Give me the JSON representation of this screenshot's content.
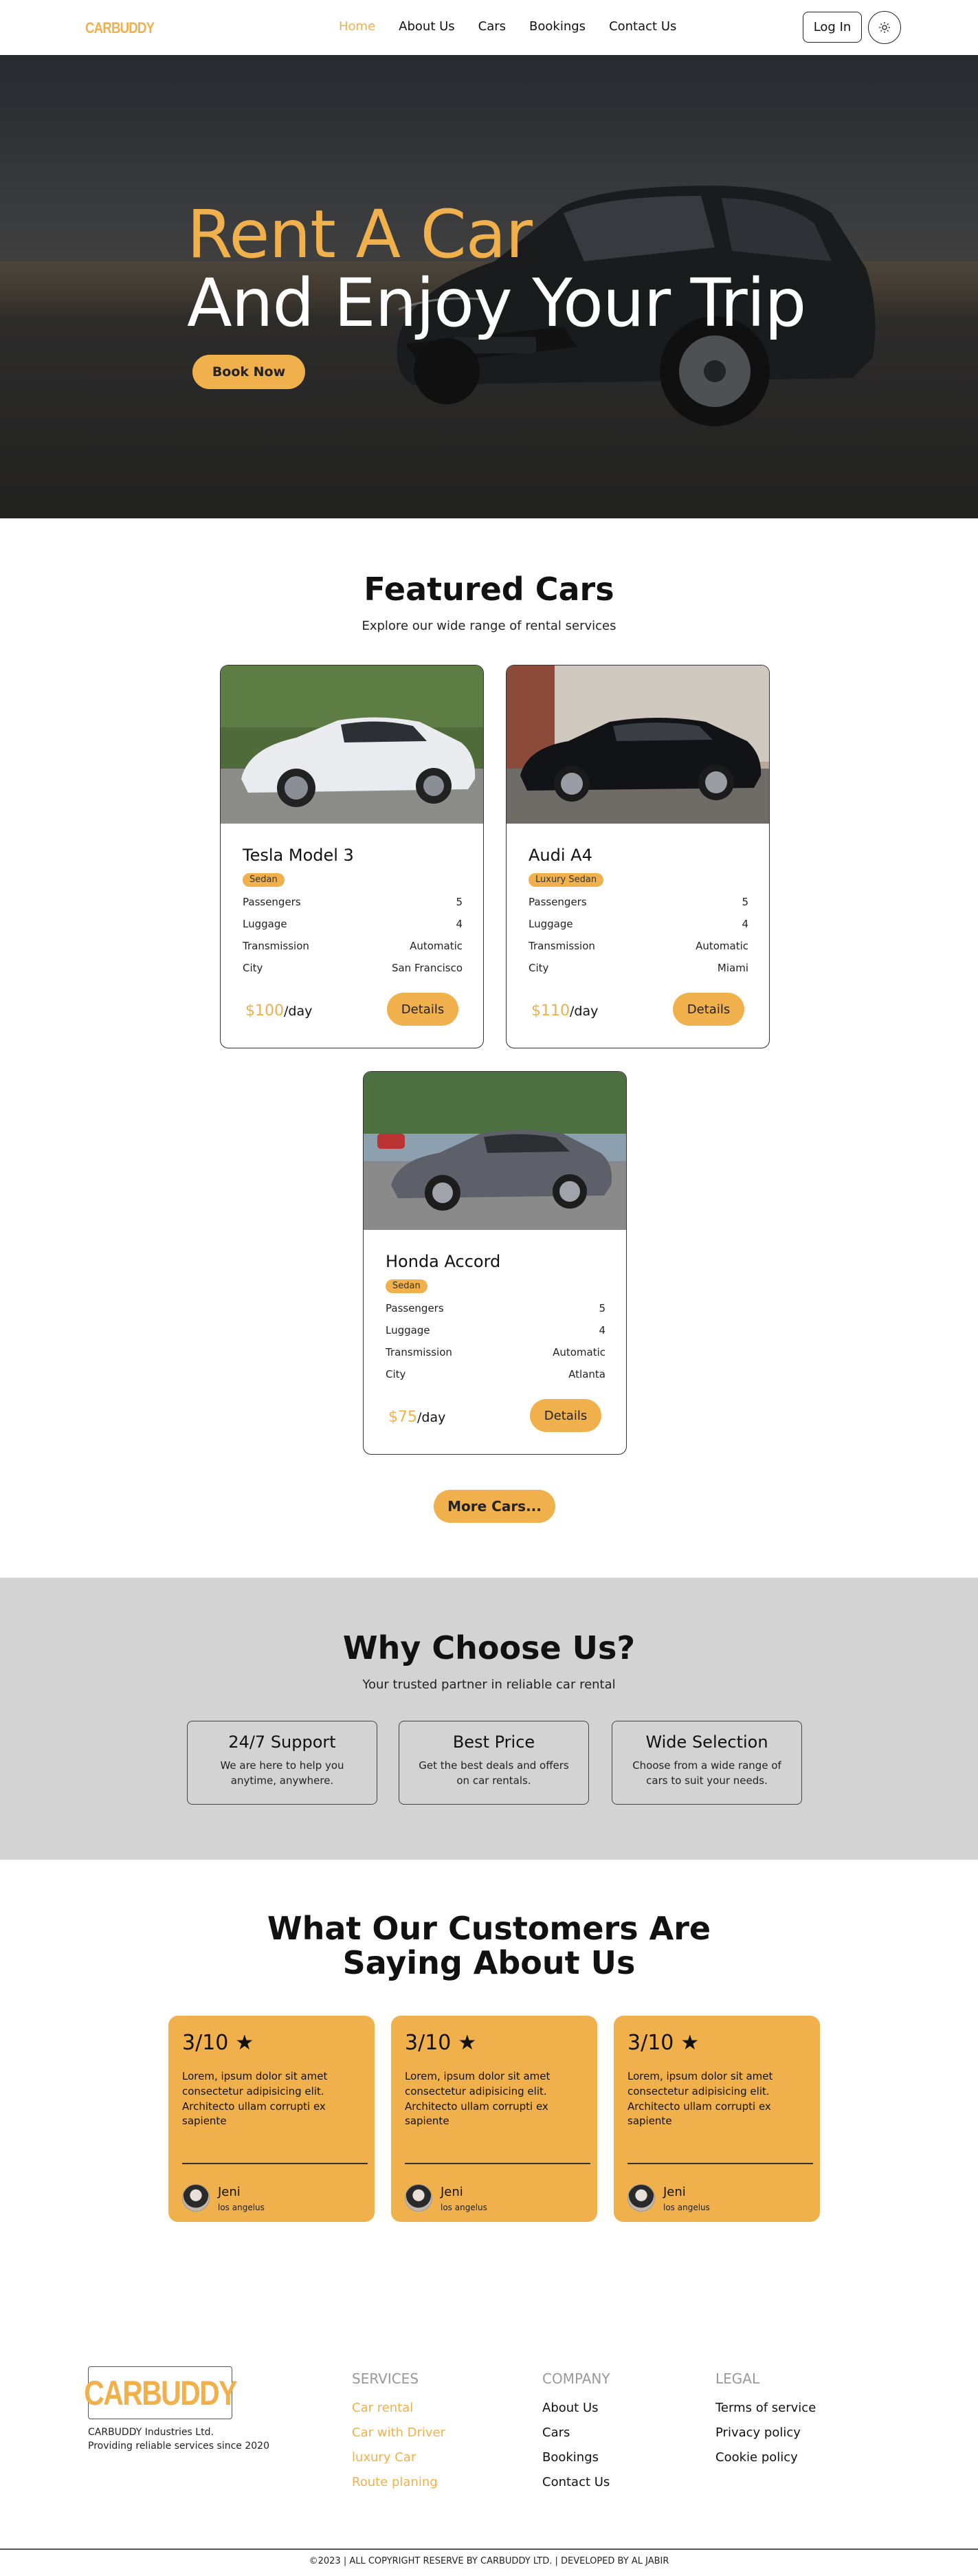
{
  "nav": {
    "logo": "CARBUDDY",
    "links": [
      "Home",
      "About Us",
      "Cars",
      "Bookings",
      "Contact Us"
    ],
    "active": "Home",
    "login": "Log In",
    "theme_icon": "sun-icon"
  },
  "hero": {
    "line1": "Rent A Car",
    "line2": "And Enjoy Your Trip",
    "cta": "Book Now"
  },
  "featured": {
    "title": "Featured Cars",
    "subtitle": "Explore our wide range of rental services",
    "spec_labels": [
      "Passengers",
      "Luggage",
      "Transmission",
      "City"
    ],
    "details_label": "Details",
    "per_day": "/day",
    "cars": [
      {
        "name": "Tesla Model 3",
        "tag": "Sedan",
        "passengers": "5",
        "luggage": "4",
        "transmission": "Automatic",
        "city": "San Francisco",
        "price": "$100"
      },
      {
        "name": "Audi A4",
        "tag": "Luxury Sedan",
        "passengers": "5",
        "luggage": "4",
        "transmission": "Automatic",
        "city": "Miami",
        "price": "$110"
      },
      {
        "name": "Honda Accord",
        "tag": "Sedan",
        "passengers": "5",
        "luggage": "4",
        "transmission": "Automatic",
        "city": "Atlanta",
        "price": "$75"
      }
    ],
    "more": "More Cars..."
  },
  "why": {
    "title": "Why Choose Us?",
    "subtitle": "Your trusted partner in reliable car rental",
    "boxes": [
      {
        "title": "24/7 Support",
        "desc": "We are here to help you anytime, anywhere."
      },
      {
        "title": "Best Price",
        "desc": "Get the best deals and offers on car rentals."
      },
      {
        "title": "Wide Selection",
        "desc": "Choose from a wide range of cars to suit your needs."
      }
    ]
  },
  "testimonials": {
    "title_line1": "What Our Customers Are",
    "title_line2": "Saying About Us",
    "items": [
      {
        "rating": "3/10",
        "text": "Lorem, ipsum dolor sit amet consectetur adipisicing elit. Architecto ullam corrupti ex sapiente",
        "name": "Jeni",
        "location": "los angelus"
      },
      {
        "rating": "3/10",
        "text": "Lorem, ipsum dolor sit amet consectetur adipisicing elit. Architecto ullam corrupti ex sapiente",
        "name": "Jeni",
        "location": "los angelus"
      },
      {
        "rating": "3/10",
        "text": "Lorem, ipsum dolor sit amet consectetur adipisicing elit. Architecto ullam corrupti ex sapiente",
        "name": "Jeni",
        "location": "los angelus"
      }
    ]
  },
  "footer": {
    "logo": "CARBUDDY",
    "tagline1": "CARBUDDY Industries Ltd.",
    "tagline2": "Providing reliable services since 2020",
    "services_title": "SERVICES",
    "services": [
      "Car rental",
      "Car with Driver",
      "luxury Car",
      "Route planing"
    ],
    "company_title": "COMPANY",
    "company": [
      "About Us",
      "Cars",
      "Bookings",
      "Contact Us"
    ],
    "legal_title": "LEGAL",
    "legal": [
      "Terms of service",
      "Privacy policy",
      "Cookie policy"
    ],
    "copyright": "©2023 | ALL COPYRIGHT RESERVE BY CARBUDDY LTD. | DEVELOPED BY AL JABIR"
  },
  "colors": {
    "accent": "#f0b04c",
    "why_bg": "#d3d3d3"
  }
}
